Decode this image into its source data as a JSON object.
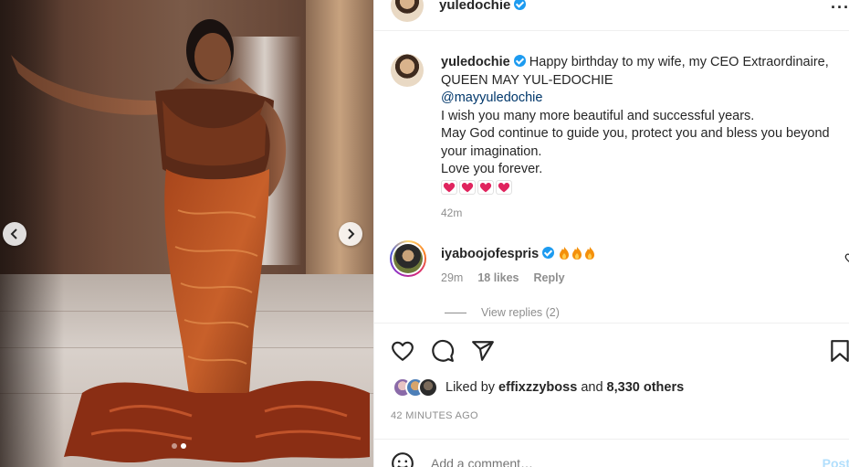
{
  "post": {
    "username": "yuledochie",
    "verified": true,
    "image_alt_icon": "photo",
    "carousel_dots": 2,
    "carousel_active": 1
  },
  "caption": {
    "username": "yuledochie",
    "line1": "Happy birthday to my wife, my CEO Extraordinaire, QUEEN MAY YUL-EDOCHIE",
    "mention": "@mayyuledochie",
    "line2": "I wish you many more beautiful and successful years.",
    "line3": "May God continue to guide you, protect you and bless you beyond your imagination.",
    "line4": "Love you forever.",
    "hearts_count": 4,
    "time": "42m"
  },
  "comment": {
    "username": "iyaboojofespris",
    "verified": true,
    "emoji_text": "🔥🔥🔥",
    "time": "29m",
    "likes": "18 likes",
    "reply_label": "Reply",
    "view_replies": "View replies (2)"
  },
  "actions": {
    "like_icon": "heart-outline-icon",
    "comment_icon": "comment-bubble-icon",
    "share_icon": "paper-plane-icon",
    "save_icon": "bookmark-icon"
  },
  "likes": {
    "prefix": "Liked by",
    "user": "effixzzyboss",
    "joiner": "and",
    "others": "8,330 others"
  },
  "post_time": "42 MINUTES AGO",
  "add_comment": {
    "placeholder": "Add a comment…",
    "post_label": "Post"
  },
  "colors": {
    "verified": "#1d9bf0",
    "mention": "#00376b",
    "secondary_text": "#8e8e8e",
    "heart": "#e0245e",
    "post_button": "#b2dffc"
  }
}
